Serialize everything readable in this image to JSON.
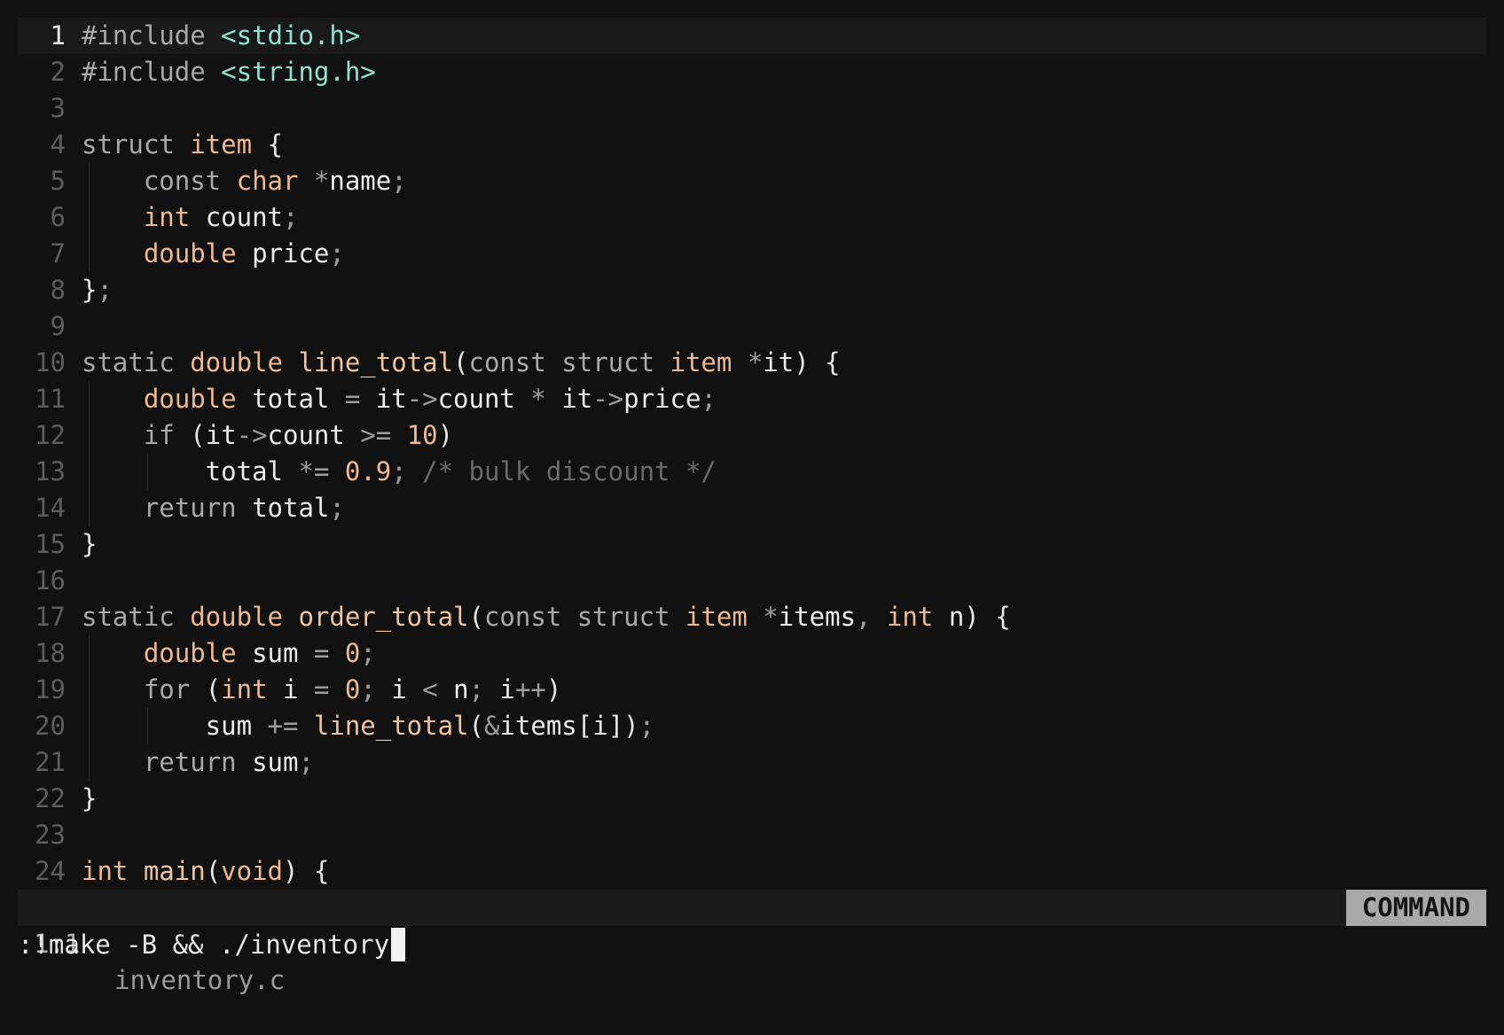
{
  "editor": {
    "filename": "inventory.c",
    "current_line": 1,
    "lines": [
      {
        "n": "1",
        "indent": [],
        "tokens": [
          [
            "pre",
            "#include "
          ],
          [
            "str",
            "<stdio.h>"
          ]
        ]
      },
      {
        "n": "2",
        "indent": [],
        "tokens": [
          [
            "pre",
            "#include "
          ],
          [
            "str",
            "<string.h>"
          ]
        ]
      },
      {
        "n": "3",
        "indent": [],
        "tokens": []
      },
      {
        "n": "4",
        "indent": [],
        "tokens": [
          [
            "kw",
            "struct "
          ],
          [
            "type",
            "item"
          ],
          [
            "br",
            " {"
          ]
        ]
      },
      {
        "n": "5",
        "indent": [
          1
        ],
        "tokens": [
          [
            "kw",
            "    const "
          ],
          [
            "type",
            "char "
          ],
          [
            "p",
            "*"
          ],
          [
            "id",
            "name"
          ],
          [
            "p",
            ";"
          ]
        ]
      },
      {
        "n": "6",
        "indent": [
          1
        ],
        "tokens": [
          [
            "type",
            "    int "
          ],
          [
            "id",
            "count"
          ],
          [
            "p",
            ";"
          ]
        ]
      },
      {
        "n": "7",
        "indent": [
          1
        ],
        "tokens": [
          [
            "type",
            "    double "
          ],
          [
            "id",
            "price"
          ],
          [
            "p",
            ";"
          ]
        ]
      },
      {
        "n": "8",
        "indent": [],
        "tokens": [
          [
            "br",
            "}"
          ],
          [
            "p",
            ";"
          ]
        ]
      },
      {
        "n": "9",
        "indent": [],
        "tokens": []
      },
      {
        "n": "10",
        "indent": [],
        "tokens": [
          [
            "kw",
            "static "
          ],
          [
            "type",
            "double "
          ],
          [
            "fn",
            "line_total"
          ],
          [
            "br",
            "("
          ],
          [
            "kw",
            "const struct "
          ],
          [
            "type",
            "item "
          ],
          [
            "p",
            "*"
          ],
          [
            "id",
            "it"
          ],
          [
            "br",
            ") {"
          ]
        ]
      },
      {
        "n": "11",
        "indent": [
          1
        ],
        "tokens": [
          [
            "type",
            "    double "
          ],
          [
            "id",
            "total "
          ],
          [
            "p",
            "= "
          ],
          [
            "id",
            "it"
          ],
          [
            "p",
            "->"
          ],
          [
            "id",
            "count "
          ],
          [
            "p",
            "* "
          ],
          [
            "id",
            "it"
          ],
          [
            "p",
            "->"
          ],
          [
            "id",
            "price"
          ],
          [
            "p",
            ";"
          ]
        ]
      },
      {
        "n": "12",
        "indent": [
          1
        ],
        "tokens": [
          [
            "kw",
            "    if "
          ],
          [
            "br",
            "("
          ],
          [
            "id",
            "it"
          ],
          [
            "p",
            "->"
          ],
          [
            "id",
            "count "
          ],
          [
            "p",
            ">= "
          ],
          [
            "num",
            "10"
          ],
          [
            "br",
            ")"
          ]
        ]
      },
      {
        "n": "13",
        "indent": [
          1,
          2
        ],
        "tokens": [
          [
            "id",
            "        total "
          ],
          [
            "p",
            "*= "
          ],
          [
            "num",
            "0.9"
          ],
          [
            "p",
            "; "
          ],
          [
            "com",
            "/* bulk discount */"
          ]
        ]
      },
      {
        "n": "14",
        "indent": [
          1
        ],
        "tokens": [
          [
            "kw",
            "    return "
          ],
          [
            "id",
            "total"
          ],
          [
            "p",
            ";"
          ]
        ]
      },
      {
        "n": "15",
        "indent": [],
        "tokens": [
          [
            "br",
            "}"
          ]
        ]
      },
      {
        "n": "16",
        "indent": [],
        "tokens": []
      },
      {
        "n": "17",
        "indent": [],
        "tokens": [
          [
            "kw",
            "static "
          ],
          [
            "type",
            "double "
          ],
          [
            "fn",
            "order_total"
          ],
          [
            "br",
            "("
          ],
          [
            "kw",
            "const struct "
          ],
          [
            "type",
            "item "
          ],
          [
            "p",
            "*"
          ],
          [
            "id",
            "items"
          ],
          [
            "p",
            ", "
          ],
          [
            "type",
            "int "
          ],
          [
            "id",
            "n"
          ],
          [
            "br",
            ") {"
          ]
        ]
      },
      {
        "n": "18",
        "indent": [
          1
        ],
        "tokens": [
          [
            "type",
            "    double "
          ],
          [
            "id",
            "sum "
          ],
          [
            "p",
            "= "
          ],
          [
            "num",
            "0"
          ],
          [
            "p",
            ";"
          ]
        ]
      },
      {
        "n": "19",
        "indent": [
          1
        ],
        "tokens": [
          [
            "kw",
            "    for "
          ],
          [
            "br",
            "("
          ],
          [
            "type",
            "int "
          ],
          [
            "id",
            "i "
          ],
          [
            "p",
            "= "
          ],
          [
            "num",
            "0"
          ],
          [
            "p",
            "; "
          ],
          [
            "id",
            "i "
          ],
          [
            "p",
            "< "
          ],
          [
            "id",
            "n"
          ],
          [
            "p",
            "; "
          ],
          [
            "id",
            "i"
          ],
          [
            "p",
            "++"
          ],
          [
            "br",
            ")"
          ]
        ]
      },
      {
        "n": "20",
        "indent": [
          1,
          2
        ],
        "tokens": [
          [
            "id",
            "        sum "
          ],
          [
            "p",
            "+= "
          ],
          [
            "fn",
            "line_total"
          ],
          [
            "br",
            "("
          ],
          [
            "p",
            "&"
          ],
          [
            "id",
            "items"
          ],
          [
            "br",
            "["
          ],
          [
            "id",
            "i"
          ],
          [
            "br",
            "])"
          ],
          [
            "p",
            ";"
          ]
        ]
      },
      {
        "n": "21",
        "indent": [
          1
        ],
        "tokens": [
          [
            "kw",
            "    return "
          ],
          [
            "id",
            "sum"
          ],
          [
            "p",
            ";"
          ]
        ]
      },
      {
        "n": "22",
        "indent": [],
        "tokens": [
          [
            "br",
            "}"
          ]
        ]
      },
      {
        "n": "23",
        "indent": [],
        "tokens": []
      },
      {
        "n": "24",
        "indent": [],
        "tokens": [
          [
            "type",
            "int "
          ],
          [
            "fn",
            "main"
          ],
          [
            "br",
            "("
          ],
          [
            "type",
            "void"
          ],
          [
            "br",
            ") {"
          ]
        ]
      }
    ]
  },
  "statusbar": {
    "position": "1:1",
    "filename": "inventory.c",
    "mode": "COMMAND"
  },
  "cmdline": {
    "text": ":!make -B && ./inventory"
  }
}
